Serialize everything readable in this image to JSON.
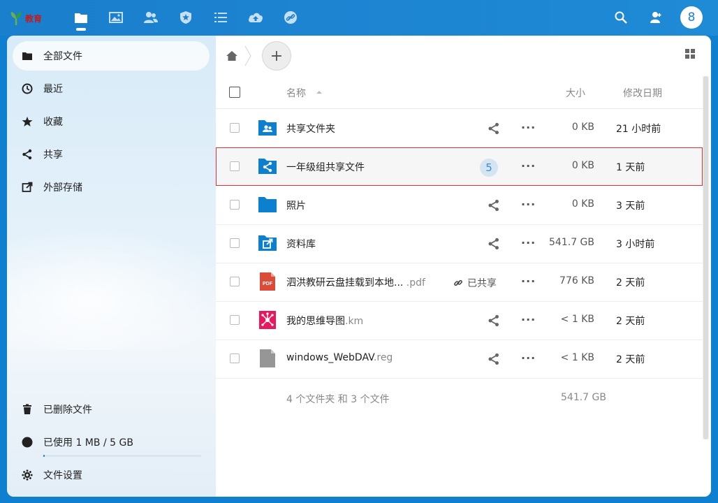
{
  "brand": {
    "logo_text": "教育"
  },
  "topbar": {
    "apps": [
      "files-icon",
      "photos-icon",
      "contacts-icon",
      "security-icon",
      "activity-icon",
      "upload-icon",
      "links-icon"
    ],
    "avatar_letter": "8"
  },
  "sidebar": {
    "items": [
      {
        "label": "全部文件",
        "icon": "folder-icon",
        "active": true
      },
      {
        "label": "最近",
        "icon": "clock-icon"
      },
      {
        "label": "收藏",
        "icon": "star-icon"
      },
      {
        "label": "共享",
        "icon": "share-icon"
      },
      {
        "label": "外部存储",
        "icon": "external-icon"
      }
    ],
    "bottom": [
      {
        "label": "已删除文件",
        "icon": "trash-icon"
      },
      {
        "label": "已使用 1 MB / 5 GB",
        "icon": "quota-icon"
      },
      {
        "label": "文件设置",
        "icon": "gear-icon"
      }
    ]
  },
  "quota_fraction": 0.0002,
  "main": {
    "add_symbol": "+",
    "header": {
      "name": "名称",
      "size": "大小",
      "modified": "修改日期"
    },
    "files": [
      {
        "name": "共享文件夹",
        "ext": "",
        "type": "shared-folder",
        "size": "0 KB",
        "date": "21 小时前"
      },
      {
        "name": "一年级组共享文件",
        "ext": "",
        "type": "share-folder",
        "size": "0 KB",
        "date": "1 天前",
        "badge": "5",
        "selected": true
      },
      {
        "name": "照片",
        "ext": "",
        "type": "folder",
        "size": "0 KB",
        "date": "3 天前"
      },
      {
        "name": "资料库",
        "ext": "",
        "type": "external-folder",
        "size": "541.7 GB",
        "date": "3 小时前"
      },
      {
        "name": "泗洪教研云盘挂载到本地...",
        "ext": " .pdf",
        "type": "pdf",
        "size": "776 KB",
        "date": "2 天前",
        "shared_label": "已共享"
      },
      {
        "name": "我的思维导图",
        "ext": ".km",
        "type": "mindmap",
        "size": "< 1 KB",
        "date": "2 天前"
      },
      {
        "name": "windows_WebDAV",
        "ext": ".reg",
        "type": "file",
        "size": "< 1 KB",
        "date": "2 天前"
      }
    ],
    "summary": {
      "text": "4 个文件夹 和 3 个文件",
      "size": "541.7 GB"
    }
  }
}
